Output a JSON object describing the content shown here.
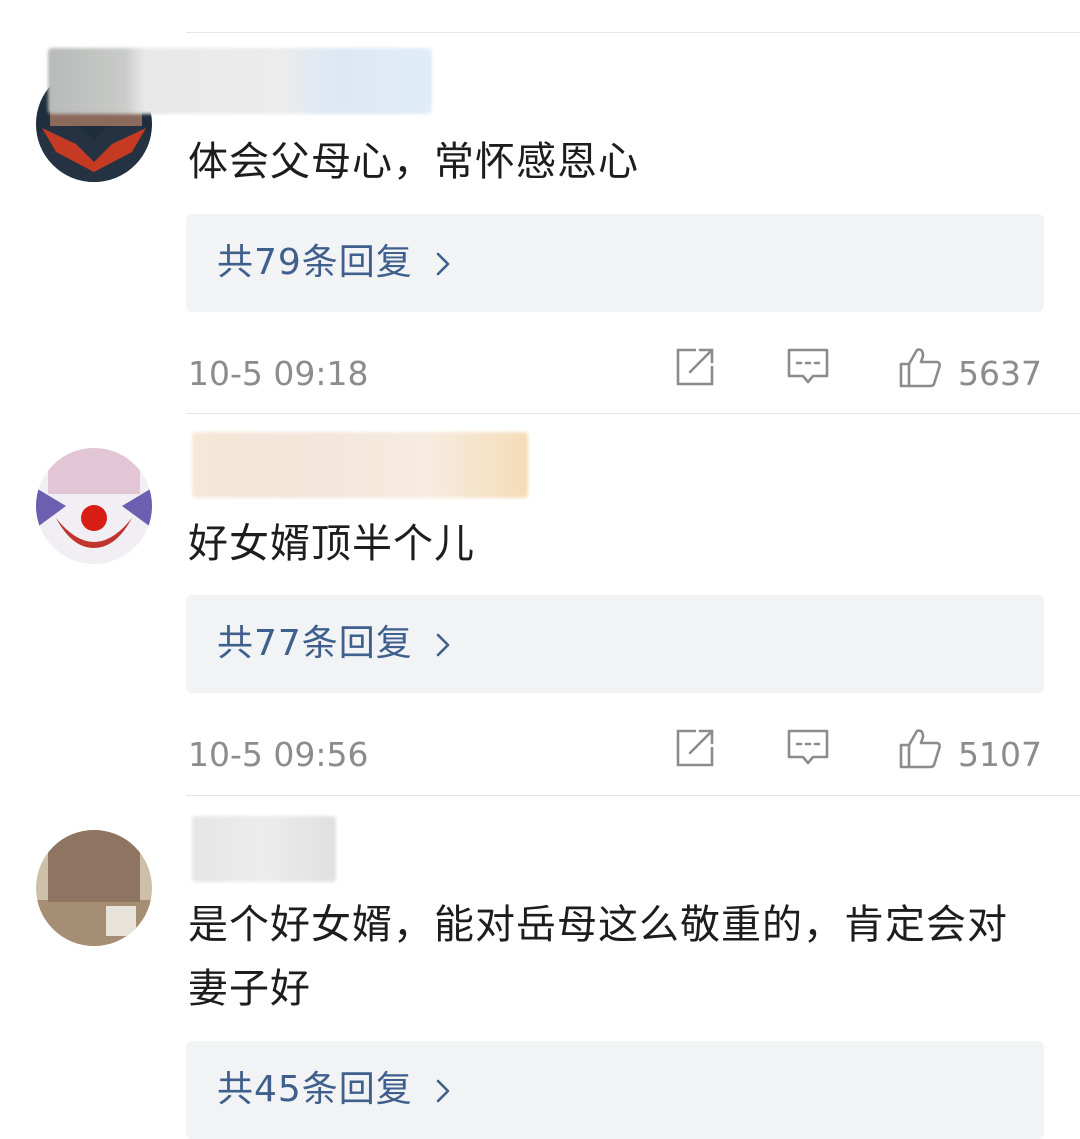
{
  "comments": [
    {
      "text": "体会父母心，常怀感恩心",
      "reply_label": "共79条回复",
      "time": "10-5 09:18",
      "likes": "5637"
    },
    {
      "text": "好女婿顶半个儿",
      "reply_label": "共77条回复",
      "time": "10-5 09:56",
      "likes": "5107"
    },
    {
      "text": "是个好女婿，能对岳母这么敬重的，肯定会对妻子好",
      "reply_label": "共45条回复"
    }
  ],
  "icons": {
    "share": "share-icon",
    "comment": "comment-icon",
    "like": "like-icon",
    "reply_more": "chevron-right-icon"
  },
  "colors": {
    "reply_link": "#3f5f8c",
    "meta_text": "#8c8c8c",
    "reply_bg": "#f2f3f5"
  }
}
